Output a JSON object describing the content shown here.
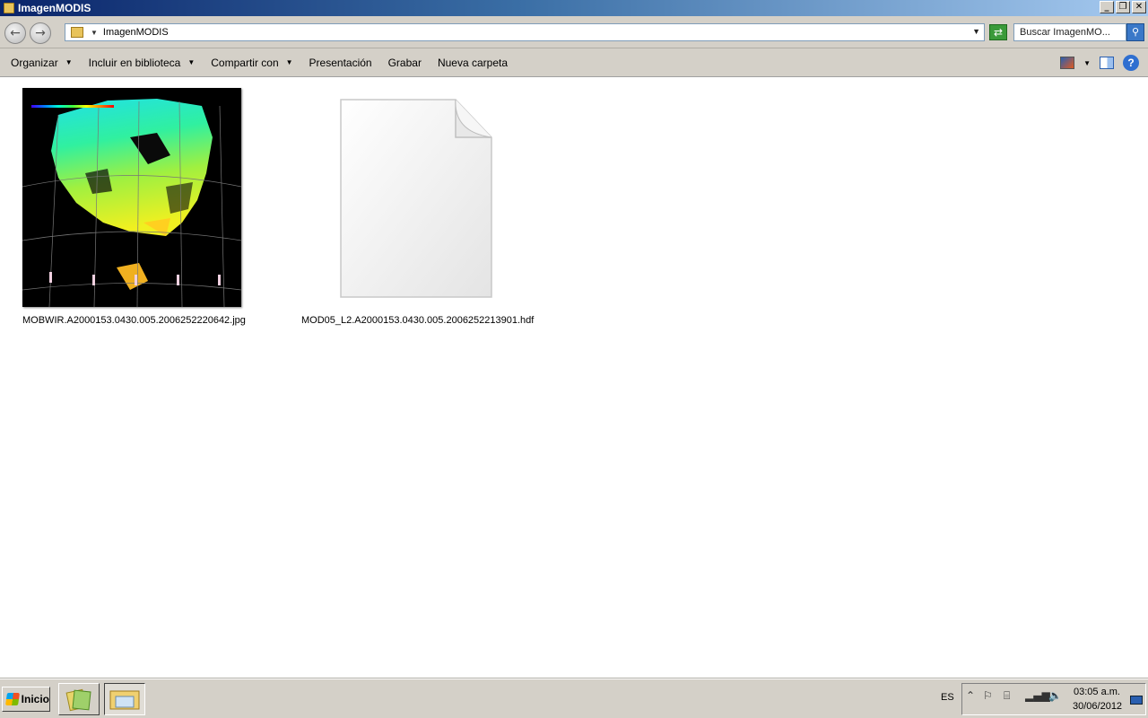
{
  "window": {
    "title": "ImagenMODIS"
  },
  "address": {
    "path": "ImagenMODIS",
    "search_placeholder": "Buscar ImagenMO..."
  },
  "toolbar": {
    "organize": "Organizar",
    "include_library": "Incluir en biblioteca",
    "share_with": "Compartir con",
    "slideshow": "Presentación",
    "burn": "Grabar",
    "new_folder": "Nueva carpeta"
  },
  "files": [
    {
      "name": "MOBWIR.A2000153.0430.005.2006252220642.jpg",
      "type": "image",
      "icon": "jpg-thumbnail"
    },
    {
      "name": "MOD05_L2.A2000153.0430.005.2006252213901.hdf",
      "type": "generic",
      "icon": "blank-document-icon"
    }
  ],
  "taskbar": {
    "start_label": "Inicio",
    "language": "ES",
    "time": "03:05 a.m.",
    "date": "30/06/2012"
  }
}
